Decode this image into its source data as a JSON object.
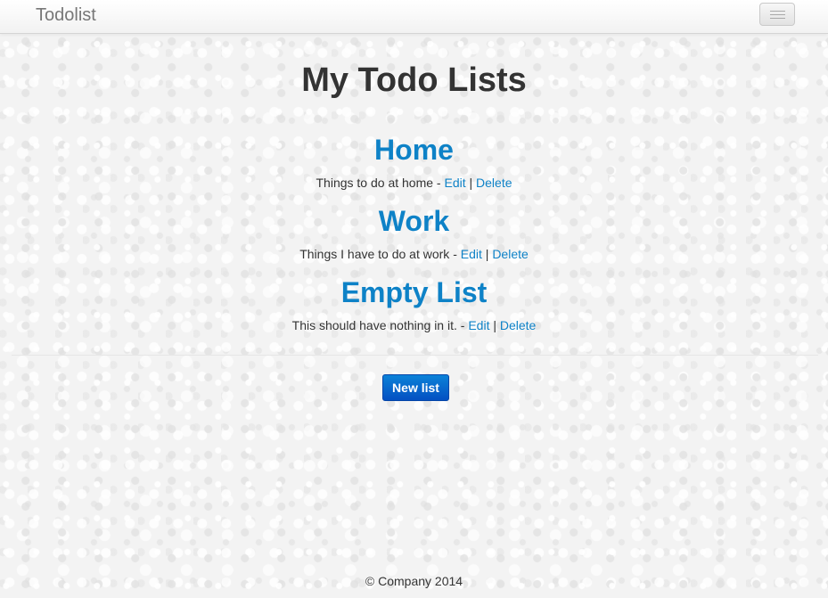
{
  "navbar": {
    "brand": "Todolist",
    "toggle_icon": "hamburger-menu-icon"
  },
  "main": {
    "title": "My Todo Lists",
    "lists": [
      {
        "title": "Home",
        "description": "Things to do at home",
        "separator": " - ",
        "edit_label": "Edit",
        "pipe": " | ",
        "delete_label": "Delete"
      },
      {
        "title": "Work",
        "description": "Things I have to do at work",
        "separator": " - ",
        "edit_label": "Edit",
        "pipe": " | ",
        "delete_label": "Delete"
      },
      {
        "title": "Empty List",
        "description": "This should have nothing in it.",
        "separator": " - ",
        "edit_label": "Edit",
        "pipe": " | ",
        "delete_label": "Delete"
      }
    ],
    "new_list_label": "New list"
  },
  "footer": {
    "text": "© Company 2014"
  },
  "colors": {
    "link": "#0e82c7",
    "button": "#0450c2",
    "text": "#333333"
  }
}
